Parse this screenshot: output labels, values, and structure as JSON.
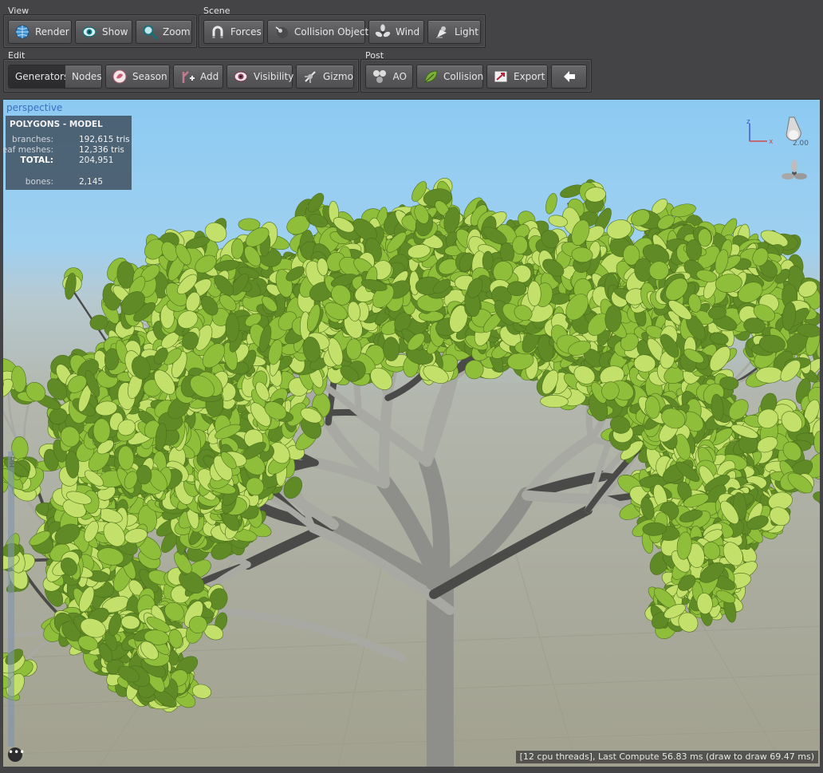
{
  "toolbar": {
    "view": {
      "title": "View",
      "render": "Render",
      "show": "Show",
      "zoom": "Zoom"
    },
    "scene": {
      "title": "Scene",
      "forces": "Forces",
      "collision_objects": "Collision Objects",
      "wind": "Wind",
      "light": "Light"
    },
    "edit": {
      "title": "Edit",
      "generators": "Generators",
      "nodes": "Nodes",
      "season": "Season",
      "add": "Add",
      "visibility": "Visibility",
      "gizmo": "Gizmo",
      "active_tab": "Generators"
    },
    "post": {
      "title": "Post",
      "ao": "AO",
      "collision": "Collision",
      "export": "Export"
    }
  },
  "viewport": {
    "camera_label": "perspective",
    "stats": {
      "title": "POLYGONS - MODEL",
      "rows": [
        {
          "label": "branches:",
          "value": "192,615 tris"
        },
        {
          "label": "leaf meshes:",
          "value": "12,336 tris"
        },
        {
          "label": "TOTAL:",
          "value": "204,951"
        },
        {
          "label": "bones:",
          "value": "2,145"
        }
      ]
    },
    "light_intensity": "2.00",
    "axis_labels": {
      "z": "z",
      "x": "x"
    },
    "ruler_label": "Hig",
    "status": "[12 cpu threads], Last Compute 56.83 ms (draw to draw 69.47 ms)",
    "more_label": "•••"
  },
  "colors": {
    "sky": "#8fc6ee",
    "ground": "#a8a99a",
    "leaf": "#8fbf3a",
    "leaf_dark": "#5f8a25",
    "branch": "#9a9a95",
    "panel": "#454547"
  },
  "icons": {
    "render": "globe-icon",
    "show": "eye-icon",
    "zoom": "magnifier-icon",
    "forces": "magnet-icon",
    "collision_objects": "sphere-icon",
    "wind": "fan-icon",
    "light": "spotlight-icon",
    "season": "season-icon",
    "add": "add-node-icon",
    "visibility": "eye-icon",
    "gizmo": "gizmo-icon",
    "ao": "ao-icon",
    "collision": "leaf-icon",
    "export": "export-icon",
    "back": "left-arrow-icon"
  }
}
